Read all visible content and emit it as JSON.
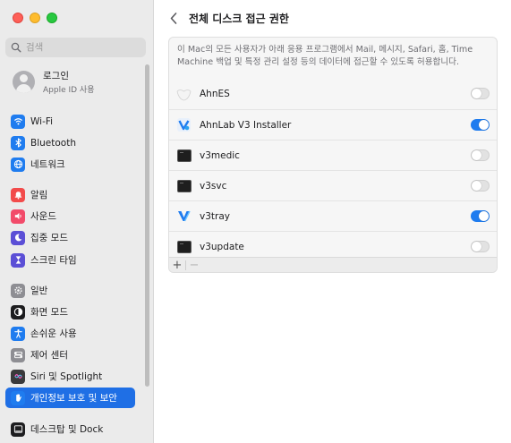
{
  "search": {
    "placeholder": "검색"
  },
  "account": {
    "name": "로그인",
    "subtitle": "Apple ID 사용"
  },
  "sidebar": {
    "items": [
      {
        "label": "Wi-Fi",
        "icon": "wifi-icon",
        "color": "#1f7cef"
      },
      {
        "label": "Bluetooth",
        "icon": "bluetooth-icon",
        "color": "#1f7cef"
      },
      {
        "label": "네트워크",
        "icon": "globe-icon",
        "color": "#1f7cef"
      },
      {
        "label": "알림",
        "icon": "bell-icon",
        "color": "#f24b4b"
      },
      {
        "label": "사운드",
        "icon": "speaker-icon",
        "color": "#f24b6a"
      },
      {
        "label": "집중 모드",
        "icon": "moon-icon",
        "color": "#5b4fd6"
      },
      {
        "label": "스크린 타임",
        "icon": "hourglass-icon",
        "color": "#5b4fd6"
      },
      {
        "label": "일반",
        "icon": "gear-icon",
        "color": "#8e8e93"
      },
      {
        "label": "화면 모드",
        "icon": "appearance-icon",
        "color": "#1d1d1f"
      },
      {
        "label": "손쉬운 사용",
        "icon": "accessibility-icon",
        "color": "#1f7cef"
      },
      {
        "label": "제어 센터",
        "icon": "control-center-icon",
        "color": "#8e8e93"
      },
      {
        "label": "Siri 및 Spotlight",
        "icon": "siri-icon",
        "color": "#3a3a3c"
      },
      {
        "label": "개인정보 보호 및 보안",
        "icon": "hand-icon",
        "color": "#1f7cef",
        "selected": true
      },
      {
        "label": "데스크탑 및 Dock",
        "icon": "dock-icon",
        "color": "#1d1d1f"
      }
    ]
  },
  "header": {
    "title": "전체 디스크 접근 권한"
  },
  "panel": {
    "description": "이 Mac의 모든 사용자가 아래 응용 프로그램에서 Mail, 메시지, Safari, 홈, Time Machine 백업 및 특정 관리 설정 등의 데이터에 접근할 수 있도록 허용합니다.",
    "apps": [
      {
        "name": "AhnES",
        "icon": "ahnes-icon",
        "enabled": false
      },
      {
        "name": "AhnLab V3 Installer",
        "icon": "ahnlab-installer-icon",
        "enabled": true
      },
      {
        "name": "v3medic",
        "icon": "terminal-icon",
        "enabled": false
      },
      {
        "name": "v3svc",
        "icon": "terminal-icon",
        "enabled": false
      },
      {
        "name": "v3tray",
        "icon": "ahnlab-v3-icon",
        "enabled": true
      },
      {
        "name": "v3update",
        "icon": "terminal-icon",
        "enabled": false
      }
    ],
    "add_label": "+",
    "remove_label": "−"
  },
  "colors": {
    "accent": "#1f7cef",
    "selected": "#1f6fe5"
  }
}
